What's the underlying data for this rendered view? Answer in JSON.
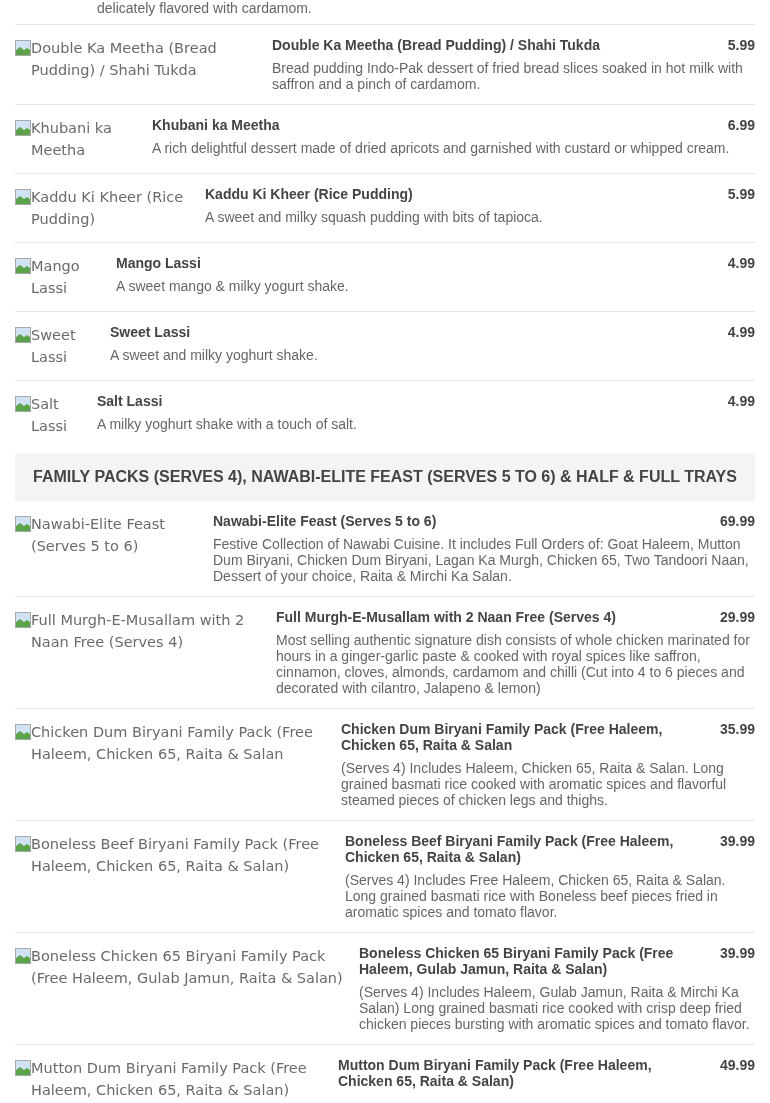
{
  "partial_item": {
    "description": "delicately flavored with cardamom."
  },
  "sections": [
    {
      "items": [
        {
          "image_alt": "Double Ka Meetha (Bread Pudding) / Shahi Tukda",
          "name": "Double Ka Meetha (Bread Pudding) / Shahi Tukda",
          "price": "5.99",
          "description": "Bread pudding Indo-Pak dessert of fried bread slices soaked in hot milk with saffron and a pinch of cardamom."
        },
        {
          "image_alt": "Khubani ka Meetha",
          "name": "Khubani ka Meetha",
          "price": "6.99",
          "description": "A rich delightful dessert made of dried apricots and garnished with custard or whipped cream."
        },
        {
          "image_alt": "Kaddu Ki Kheer (Rice Pudding)",
          "name": "Kaddu Ki Kheer (Rice Pudding)",
          "price": "5.99",
          "description": "A sweet and milky squash pudding with bits of tapioca."
        },
        {
          "image_alt": "Mango Lassi",
          "name": "Mango Lassi",
          "price": "4.99",
          "description": "A sweet mango & milky yogurt shake."
        },
        {
          "image_alt": "Sweet Lassi",
          "name": "Sweet Lassi",
          "price": "4.99",
          "description": "A sweet and milky yoghurt shake."
        },
        {
          "image_alt": "Salt Lassi",
          "name": "Salt Lassi",
          "price": "4.99",
          "description": "A milky yoghurt shake with a touch of salt."
        }
      ]
    },
    {
      "header": "FAMILY PACKS (SERVES 4), NAWABI-ELITE FEAST (SERVES 5 TO 6) & HALF & FULL TRAYS",
      "items": [
        {
          "image_alt": "Nawabi-Elite Feast (Serves 5 to 6)",
          "name": "Nawabi-Elite Feast (Serves 5 to 6)",
          "price": "69.99",
          "description": "Festive Collection of Nawabi Cuisine. It includes Full Orders of: Goat Haleem, Mutton Dum Biryani, Chicken Dum Biryani, Lagan Ka Murgh, Chicken 65, Two Tandoori Naan, Dessert of your choice, Raita & Mirchi Ka Salan."
        },
        {
          "image_alt": "Full Murgh-E-Musallam with 2 Naan Free (Serves 4)",
          "name": "Full Murgh-E-Musallam with 2 Naan Free (Serves 4)",
          "price": "29.99",
          "description": "Most selling authentic signature dish consists of whole chicken marinated for hours in a ginger-garlic paste & cooked with royal spices like saffron, cinnamon, cloves, almonds, cardamom and chilli (Cut into 4 to 6 pieces and decorated with cilantro, Jalapeno & lemon)"
        },
        {
          "image_alt": "Chicken Dum Biryani Family Pack (Free Haleem, Chicken 65, Raita & Salan",
          "name": "Chicken Dum Biryani Family Pack (Free Haleem, Chicken 65, Raita & Salan",
          "price": "35.99",
          "description": "(Serves 4) Includes Haleem, Chicken 65, Raita & Salan. Long grained basmati rice cooked with aromatic spices and flavorful steamed pieces of chicken legs and thighs."
        },
        {
          "image_alt": "Boneless Beef Biryani Family Pack (Free Haleem, Chicken 65, Raita & Salan)",
          "name": "Boneless Beef Biryani Family Pack (Free Haleem, Chicken 65, Raita & Salan)",
          "price": "39.99",
          "description": "(Serves 4) Includes Free Haleem, Chicken 65, Raita & Salan. Long grained basmati rice with Boneless beef pieces fried in aromatic spices and tomato flavor."
        },
        {
          "image_alt": "Boneless Chicken 65 Biryani Family Pack (Free Haleem, Gulab Jamun, Raita & Salan)",
          "name": "Boneless Chicken 65 Biryani Family Pack (Free Haleem, Gulab Jamun, Raita & Salan)",
          "price": "39.99",
          "description": "(Serves 4) Includes Haleem, Gulab Jamun, Raita & Mirchi Ka Salan) Long grained basmati rice cooked with crisp deep fried chicken pieces bursting with aromatic spices and tomato flavor."
        },
        {
          "image_alt": "Mutton Dum Biryani Family Pack (Free Haleem, Chicken 65, Raita & Salan)",
          "name": "Mutton Dum Biryani Family Pack (Free Haleem, Chicken 65, Raita & Salan)",
          "price": "49.99"
        }
      ]
    }
  ]
}
